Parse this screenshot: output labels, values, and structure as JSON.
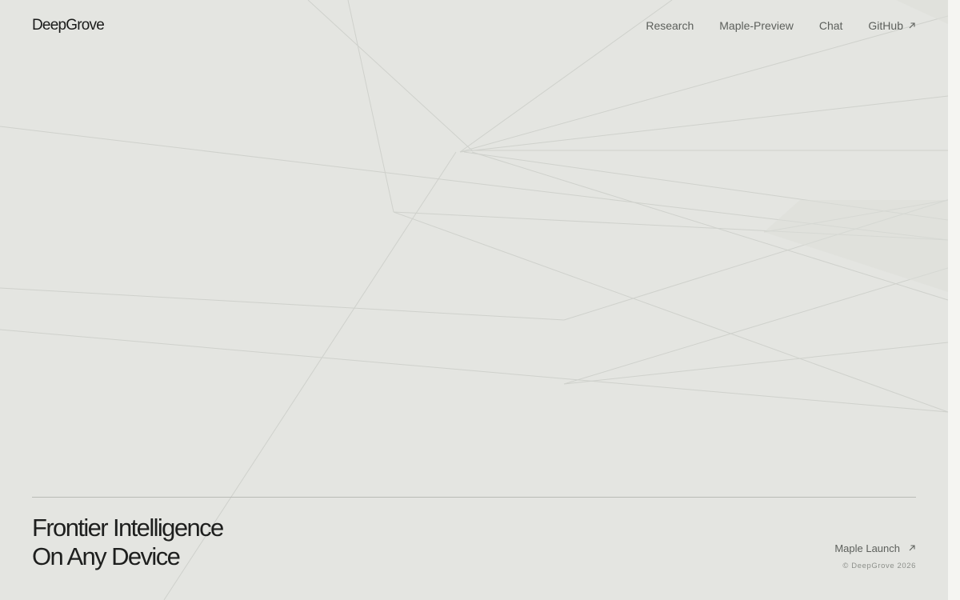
{
  "brand": {
    "name": "DeepGrove"
  },
  "nav": {
    "items": [
      {
        "label": "Research"
      },
      {
        "label": "Maple-Preview"
      },
      {
        "label": "Chat"
      },
      {
        "label": "GitHub",
        "icon": "arrow-up-right-icon"
      }
    ]
  },
  "hero": {
    "line1": "Frontier Intelligence",
    "line2": "On Any Device"
  },
  "footer": {
    "launch_label": "Maple Launch",
    "launch_icon": "arrow-up-right-icon",
    "copyright": "© DeepGrove 2026"
  },
  "colors": {
    "background": "#e4e5e1",
    "text": "#1e1f1e",
    "muted_text": "#5d605c",
    "line": "#b9bbb6"
  }
}
